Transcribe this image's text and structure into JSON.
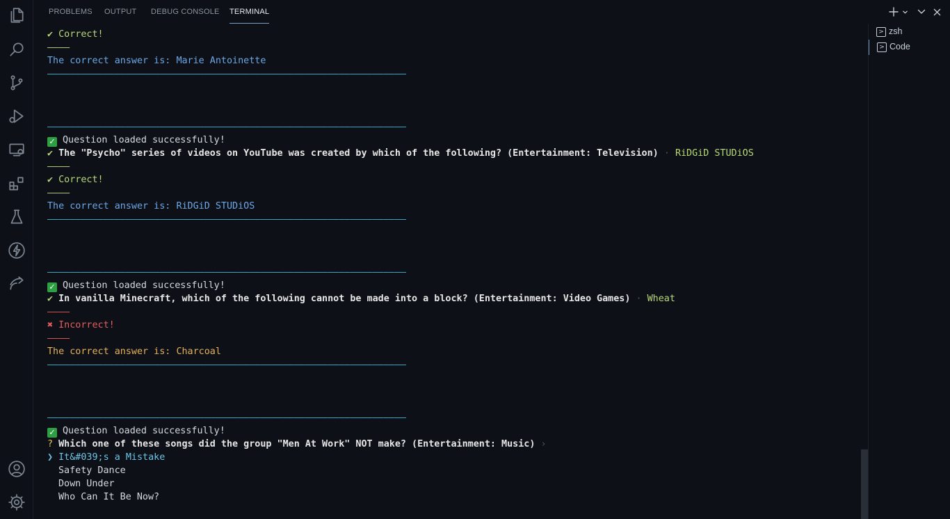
{
  "panel": {
    "tabs": [
      {
        "label": "PROBLEMS"
      },
      {
        "label": "OUTPUT"
      },
      {
        "label": "DEBUG CONSOLE"
      },
      {
        "label": "TERMINAL"
      }
    ],
    "active_tab": "TERMINAL"
  },
  "activity_bar": {
    "icons": [
      "explorer-icon",
      "search-icon",
      "source-control-icon",
      "run-debug-icon",
      "remote-explorer-icon",
      "extensions-icon",
      "testing-icon",
      "lightning-icon",
      "remote-icon",
      "account-icon",
      "settings-gear-icon"
    ]
  },
  "controls": {
    "icons": [
      "new-terminal-icon",
      "chevron-down-icon",
      "maximize-panel-icon",
      "close-icon"
    ]
  },
  "terminals": [
    {
      "label": "zsh"
    },
    {
      "label": "Code"
    }
  ],
  "terminal": {
    "correct_check": "✔",
    "correct_text": "Correct!",
    "short_sep": "————",
    "long_sep": "————————————————————————————————————————————————————————————————",
    "loaded_text": "Question loaded successfully!",
    "answer_prefix": "The correct answer is: ",
    "incorrect_mark": "✖",
    "incorrect_text": "Incorrect!",
    "q_mark": "?",
    "separator_dot": "·",
    "prompt_arrow": "›",
    "pointer": "❯",
    "block1": {
      "answer": "Marie Antoinette"
    },
    "block2": {
      "question": "The \"Psycho\" series of videos on YouTube was created by which of the following? (Entertainment: Television)",
      "chosen": "RiDGiD STUDiOS",
      "answer": "RiDGiD STUDiOS"
    },
    "block3": {
      "question": "In vanilla Minecraft, which of the following cannot be made into a block? (Entertainment: Video Games)",
      "chosen": "Wheat",
      "answer": "Charcoal"
    },
    "block4": {
      "question": "Which one of these songs did the group \"Men At Work\" NOT make? (Entertainment: Music)",
      "options": [
        "It&#039;s a Mistake",
        "Safety Dance",
        "Down Under",
        "Who Can It Be Now?"
      ]
    }
  }
}
